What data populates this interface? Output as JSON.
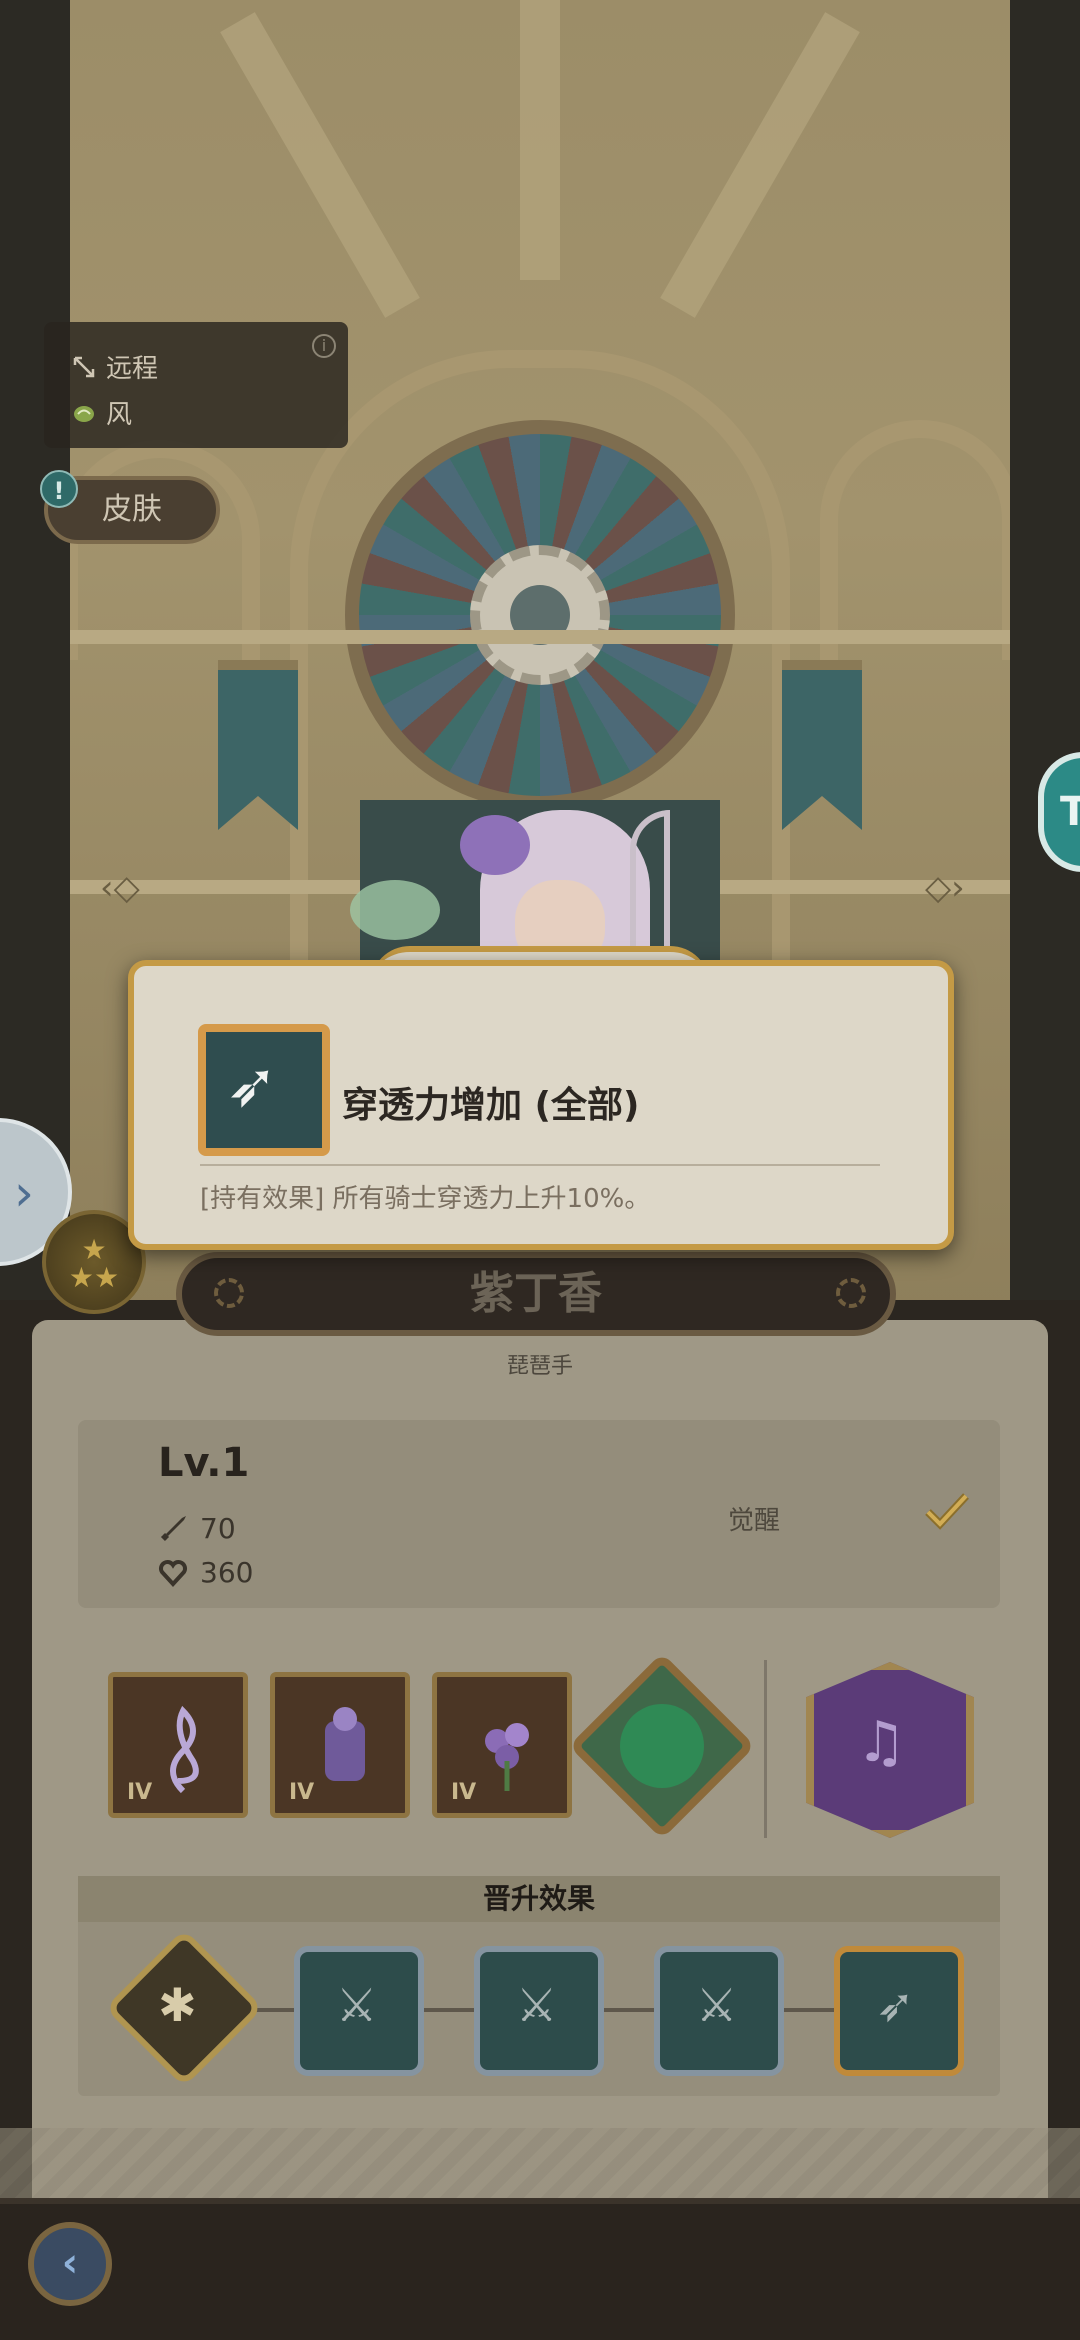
{
  "hero_info": {
    "attack_type": "远程",
    "element": "风",
    "info_icon": "info-icon"
  },
  "skin_button": {
    "label": "皮肤",
    "alert": "!"
  },
  "side_badge": {
    "label": "T"
  },
  "popup": {
    "title": "穿透力增加 (全部)",
    "description": "[持有效果] 所有骑士穿透力上升10%。"
  },
  "hero": {
    "name": "紫丁香",
    "class": "琵琶手",
    "level": "Lv.1",
    "attack": "70",
    "hp": "360",
    "awaken_label": "觉醒"
  },
  "equipment": [
    {
      "tier": "IV",
      "icon": "treble-clef-icon"
    },
    {
      "tier": "IV",
      "icon": "costume-icon"
    },
    {
      "tier": "IV",
      "icon": "flower-bouquet-icon"
    },
    {
      "tier": "",
      "icon": "wind-emblem-icon"
    }
  ],
  "advance": {
    "title": "晋升效果",
    "nodes": [
      "bug-icon",
      "sword-icon",
      "sword-up-icon",
      "sword-double-up-icon",
      "penetration-icon"
    ]
  },
  "colors": {
    "accent_gold": "#c49a45",
    "teal": "#2f4d4f",
    "panel": "#9f9886"
  }
}
